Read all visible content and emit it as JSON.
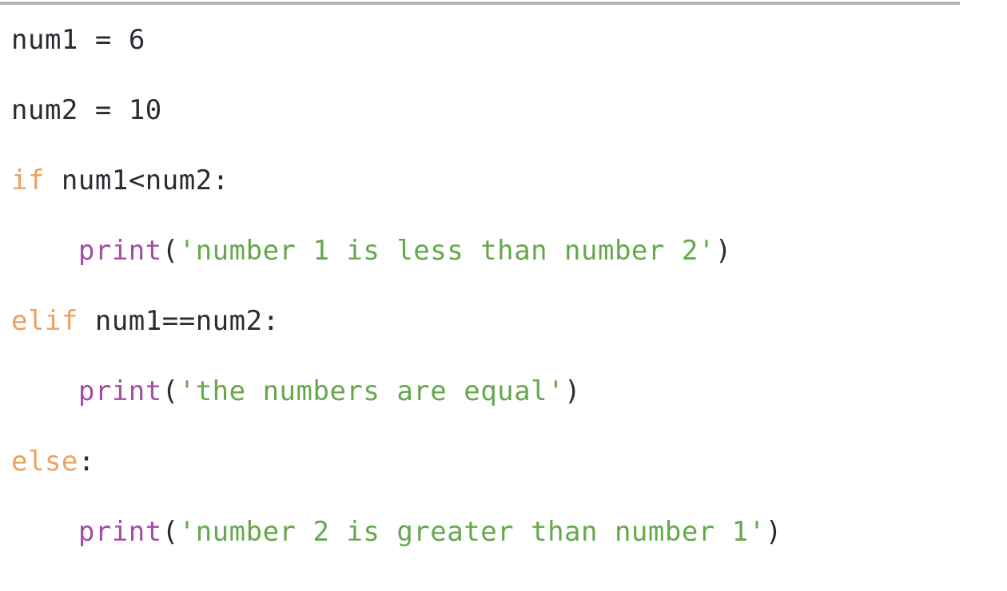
{
  "document": {
    "kind": "code-snippet",
    "language": "Python",
    "full_text": "num1 = 6\nnum2 = 10\nif num1<num2:\n    print('number 1 is less than number 2')\nelif num1==num2:\n    print('the numbers are equal')\nelse:\n    print('number 2 is greater than number 1')"
  },
  "theme": {
    "background": "#ffffff",
    "plain": "#2b2b33",
    "keyword": "#eda15f",
    "builtin": "#a64ca6",
    "string": "#65a84c",
    "rule": "#b4b4b4"
  },
  "divider": {
    "name": "top-horizontal-rule"
  },
  "code": {
    "lines": [
      {
        "id": "line-1",
        "text": "num1 = 6",
        "tokens": [
          {
            "t": "num1",
            "k": "plain"
          },
          {
            "t": " = ",
            "k": "op"
          },
          {
            "t": "6",
            "k": "number"
          }
        ]
      },
      {
        "id": "line-2",
        "text": "num2 = 10",
        "tokens": [
          {
            "t": "num2",
            "k": "plain"
          },
          {
            "t": " = ",
            "k": "op"
          },
          {
            "t": "10",
            "k": "number"
          }
        ]
      },
      {
        "id": "line-3",
        "text": "if num1<num2:",
        "tokens": [
          {
            "t": "if",
            "k": "keyword"
          },
          {
            "t": " num1",
            "k": "plain"
          },
          {
            "t": "<",
            "k": "op"
          },
          {
            "t": "num2",
            "k": "plain"
          },
          {
            "t": ":",
            "k": "punct"
          }
        ]
      },
      {
        "id": "line-4",
        "text": "    print('number 1 is less than number 2')",
        "tokens": [
          {
            "t": "    ",
            "k": "indent"
          },
          {
            "t": "print",
            "k": "builtin"
          },
          {
            "t": "(",
            "k": "punct"
          },
          {
            "t": "'number 1 is less than number 2'",
            "k": "string"
          },
          {
            "t": ")",
            "k": "punct"
          }
        ]
      },
      {
        "id": "line-5",
        "text": "elif num1==num2:",
        "tokens": [
          {
            "t": "elif",
            "k": "keyword"
          },
          {
            "t": " num1",
            "k": "plain"
          },
          {
            "t": "==",
            "k": "op"
          },
          {
            "t": "num2",
            "k": "plain"
          },
          {
            "t": ":",
            "k": "punct"
          }
        ]
      },
      {
        "id": "line-6",
        "text": "    print('the numbers are equal')",
        "tokens": [
          {
            "t": "    ",
            "k": "indent"
          },
          {
            "t": "print",
            "k": "builtin"
          },
          {
            "t": "(",
            "k": "punct"
          },
          {
            "t": "'the numbers are equal'",
            "k": "string"
          },
          {
            "t": ")",
            "k": "punct"
          }
        ]
      },
      {
        "id": "line-7",
        "text": "else:",
        "tokens": [
          {
            "t": "else",
            "k": "keyword"
          },
          {
            "t": ":",
            "k": "punct"
          }
        ]
      },
      {
        "id": "line-8",
        "text": "    print('number 2 is greater than number 1')",
        "tokens": [
          {
            "t": "    ",
            "k": "indent"
          },
          {
            "t": "print",
            "k": "builtin"
          },
          {
            "t": "(",
            "k": "punct"
          },
          {
            "t": "'number 2 is greater than number 1'",
            "k": "string"
          },
          {
            "t": ")",
            "k": "punct"
          }
        ]
      }
    ]
  }
}
